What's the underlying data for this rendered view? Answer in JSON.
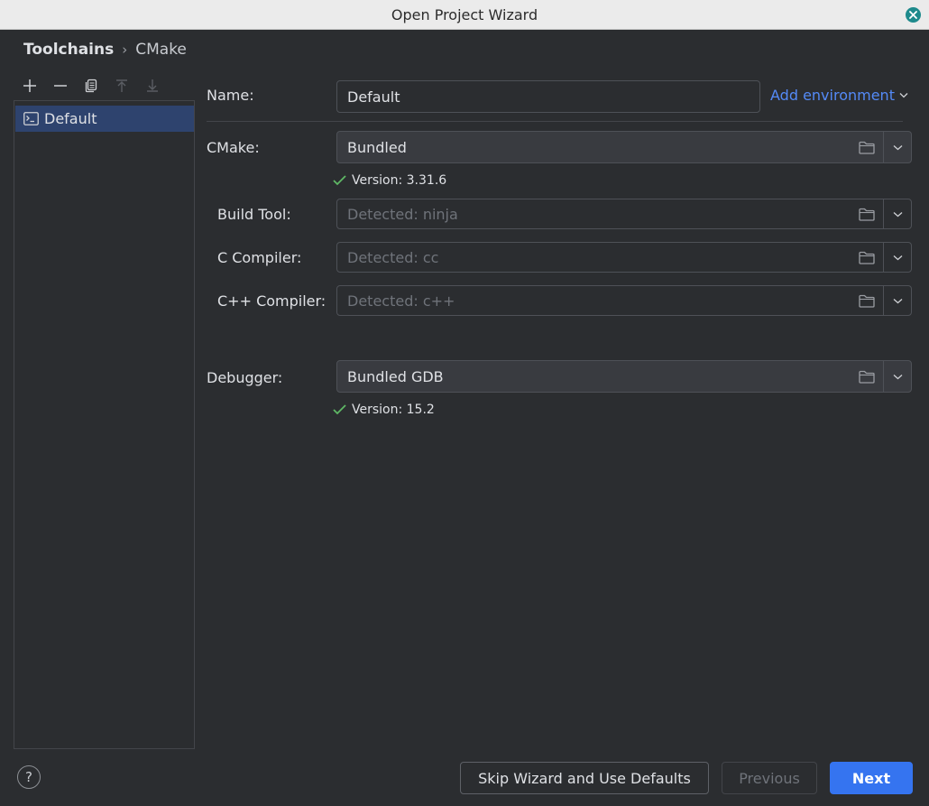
{
  "window": {
    "title": "Open Project Wizard"
  },
  "breadcrumb": {
    "root": "Toolchains",
    "separator": "›",
    "current": "CMake"
  },
  "toolchains": {
    "items": [
      {
        "label": "Default",
        "selected": true
      }
    ]
  },
  "form": {
    "name": {
      "label": "Name:",
      "value": "Default"
    },
    "add_environment": "Add environment",
    "cmake": {
      "label": "CMake:",
      "value": "Bundled",
      "version": "Version: 3.31.6"
    },
    "build_tool": {
      "label": "Build Tool:",
      "placeholder": "Detected: ninja"
    },
    "c_compiler": {
      "label": "C Compiler:",
      "placeholder": "Detected: cc"
    },
    "cpp_compiler": {
      "label": "C++ Compiler:",
      "placeholder": "Detected: c++"
    },
    "debugger": {
      "label": "Debugger:",
      "value": "Bundled GDB",
      "version": "Version: 15.2"
    }
  },
  "footer": {
    "help": "?",
    "skip": "Skip Wizard and Use Defaults",
    "previous": "Previous",
    "next": "Next"
  },
  "colors": {
    "accent": "#3574f0",
    "link": "#548af7",
    "success": "#5fb865",
    "selection": "#2e436e"
  }
}
